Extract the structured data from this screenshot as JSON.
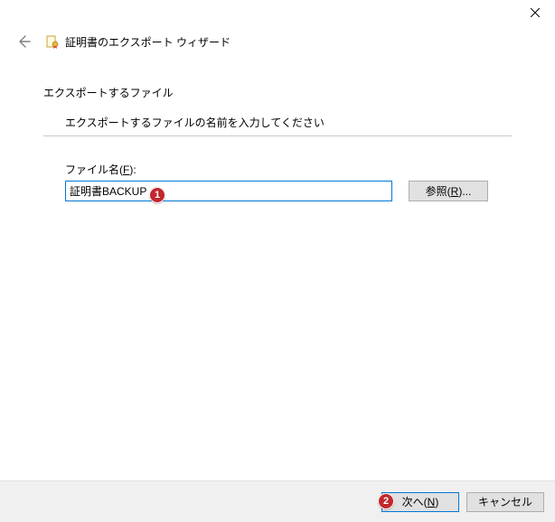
{
  "window": {
    "title": "証明書のエクスポート ウィザード"
  },
  "section": {
    "heading": "エクスポートするファイル",
    "sub": "エクスポートするファイルの名前を入力してください"
  },
  "form": {
    "filename_label_prefix": "ファイル名(",
    "filename_label_key": "F",
    "filename_label_suffix": "):",
    "filename_value": "証明書BACKUP",
    "browse_prefix": "参照(",
    "browse_key": "R",
    "browse_suffix": ")..."
  },
  "footer": {
    "next_prefix": "次へ(",
    "next_key": "N",
    "next_suffix": ")",
    "cancel": "キャンセル"
  },
  "markers": {
    "m1": "1",
    "m2": "2"
  }
}
